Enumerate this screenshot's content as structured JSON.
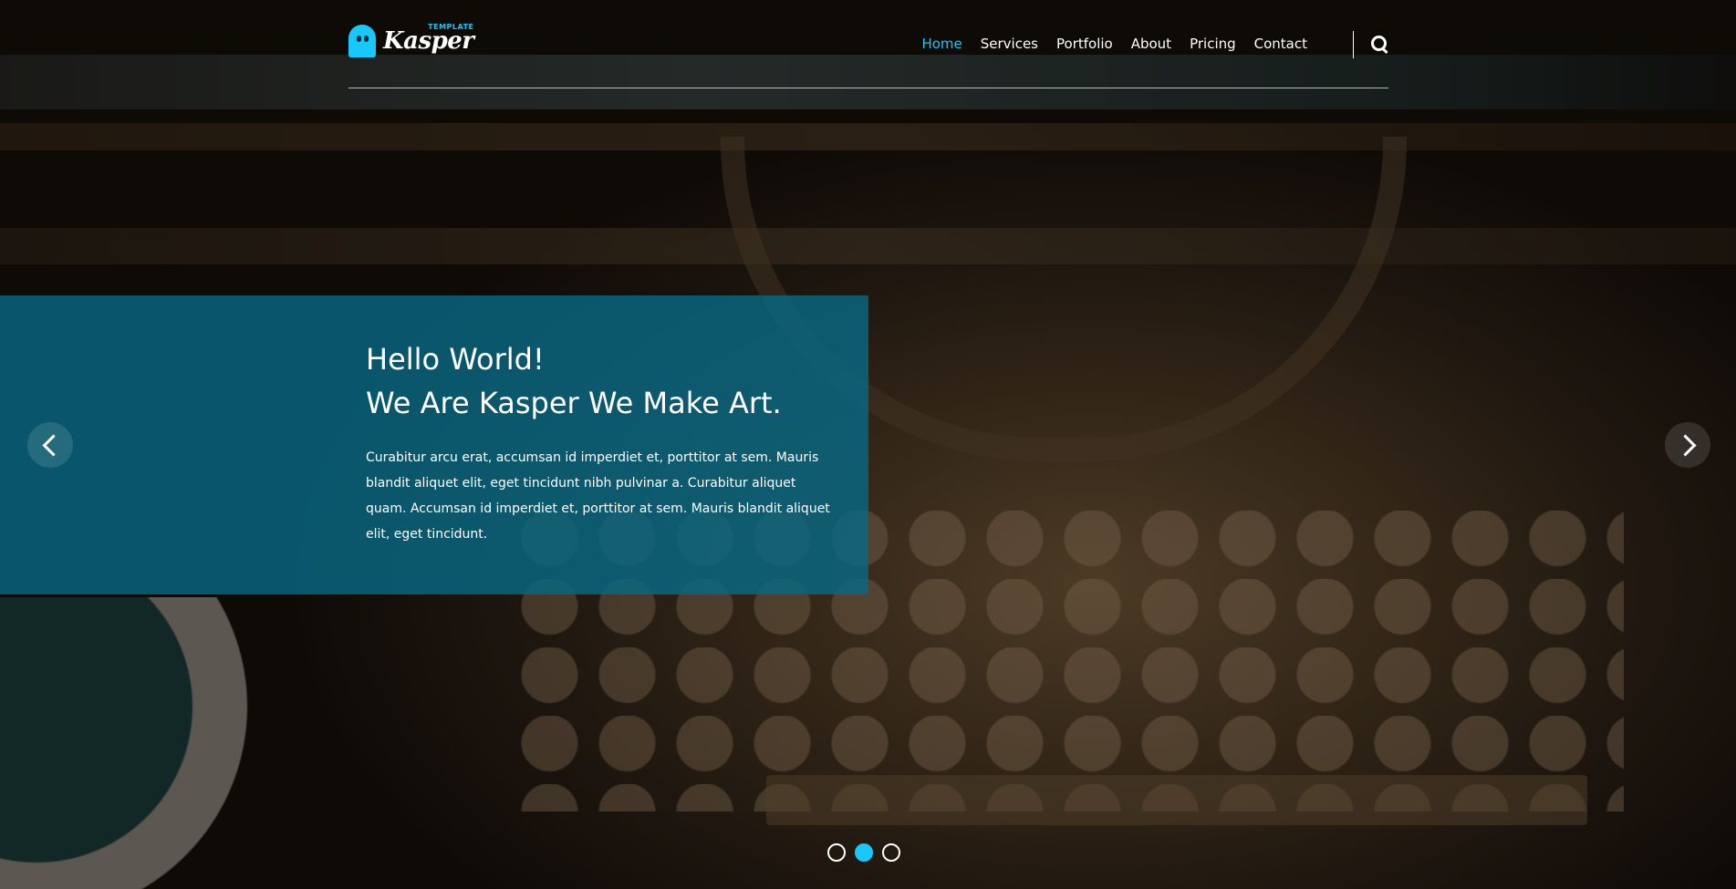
{
  "brand": {
    "name": "Kasper",
    "tagline": "TEMPLATE",
    "logo_icon": "ghost-icon",
    "accent_color": "#19c8fa"
  },
  "nav": {
    "items": [
      {
        "label": "Home",
        "active": true
      },
      {
        "label": "Services",
        "active": false
      },
      {
        "label": "Portfolio",
        "active": false
      },
      {
        "label": "About",
        "active": false
      },
      {
        "label": "Pricing",
        "active": false
      },
      {
        "label": "Contact",
        "active": false
      }
    ],
    "search_icon": "search-icon"
  },
  "hero": {
    "title_line1": "Hello World!",
    "title_line2": "We Are Kasper We Make Art.",
    "description": "Curabitur arcu erat, accumsan id imperdiet et, porttitor at sem. Mauris blandit aliquet elit, eget tincidunt nibh pulvinar a. Curabitur aliquet quam. Accumsan id imperdiet et, porttitor at sem. Mauris blandit aliquet elit, eget tincidunt.",
    "panel_color": "#096883"
  },
  "slider": {
    "prev_icon": "chevron-left-icon",
    "next_icon": "chevron-right-icon",
    "slide_count": 3,
    "active_slide": 2
  }
}
